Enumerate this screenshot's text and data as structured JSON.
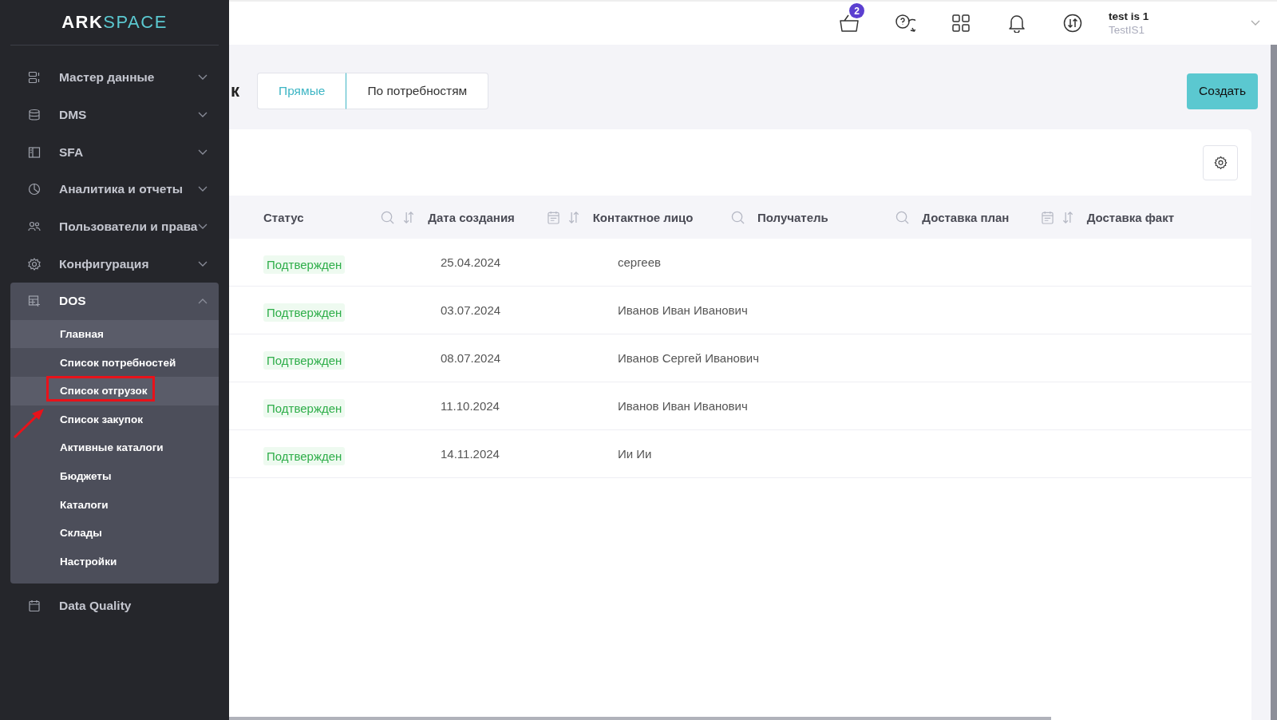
{
  "sidebar": {
    "logo": {
      "first": "ARK",
      "second": "SPACE"
    },
    "items": [
      {
        "label": "Мастер данные",
        "expanded": false
      },
      {
        "label": "DMS",
        "expanded": false
      },
      {
        "label": "SFA",
        "expanded": false
      },
      {
        "label": "Аналитика и отчеты",
        "expanded": false
      },
      {
        "label": "Пользователи и права",
        "expanded": false
      },
      {
        "label": "Конфигурация",
        "expanded": false
      },
      {
        "label": "DOS",
        "expanded": true,
        "children": [
          {
            "label": "Главная",
            "selected": false,
            "hovered": true
          },
          {
            "label": "Список потребностей",
            "selected": false,
            "hovered": false
          },
          {
            "label": "Список отгрузок",
            "selected": true,
            "hovered": false
          },
          {
            "label": "Список закупок",
            "selected": false,
            "hovered": false
          },
          {
            "label": "Активные каталоги",
            "selected": false,
            "hovered": false
          },
          {
            "label": "Бюджеты",
            "selected": false,
            "hovered": false
          },
          {
            "label": "Каталоги",
            "selected": false,
            "hovered": false
          },
          {
            "label": "Склады",
            "selected": false,
            "hovered": false
          },
          {
            "label": "Настройки",
            "selected": false,
            "hovered": false
          }
        ]
      },
      {
        "label": "Data Quality"
      }
    ]
  },
  "topbar": {
    "cart_badge": "2",
    "user": {
      "name": "test is 1",
      "login": "TestIS1"
    }
  },
  "page": {
    "title_fragment": "к",
    "tabs": [
      {
        "label": "Прямые",
        "selected": true
      },
      {
        "label": "По потребностям",
        "selected": false
      }
    ],
    "create_button": "Создать"
  },
  "table": {
    "columns": [
      {
        "label": "Статус",
        "kind": "search-sort"
      },
      {
        "label": "Дата создания",
        "kind": "date-sort"
      },
      {
        "label": "Контактное лицо",
        "kind": "search"
      },
      {
        "label": "Получатель",
        "kind": "search"
      },
      {
        "label": "Доставка план",
        "kind": "date-sort"
      },
      {
        "label": "Доставка факт",
        "kind": "plain"
      }
    ],
    "rows": [
      {
        "status": "Подтвержден",
        "created": "25.04.2024",
        "contact": "сергеев"
      },
      {
        "status": "Подтвержден",
        "created": "03.07.2024",
        "contact": "Иванов Иван Иванович"
      },
      {
        "status": "Подтвержден",
        "created": "08.07.2024",
        "contact": "Иванов Сергей Иванович"
      },
      {
        "status": "Подтвержден",
        "created": "11.10.2024",
        "contact": "Иванов Иван Иванович"
      },
      {
        "status": "Подтвержден",
        "created": "14.11.2024",
        "contact": "Ии Ии"
      }
    ]
  }
}
